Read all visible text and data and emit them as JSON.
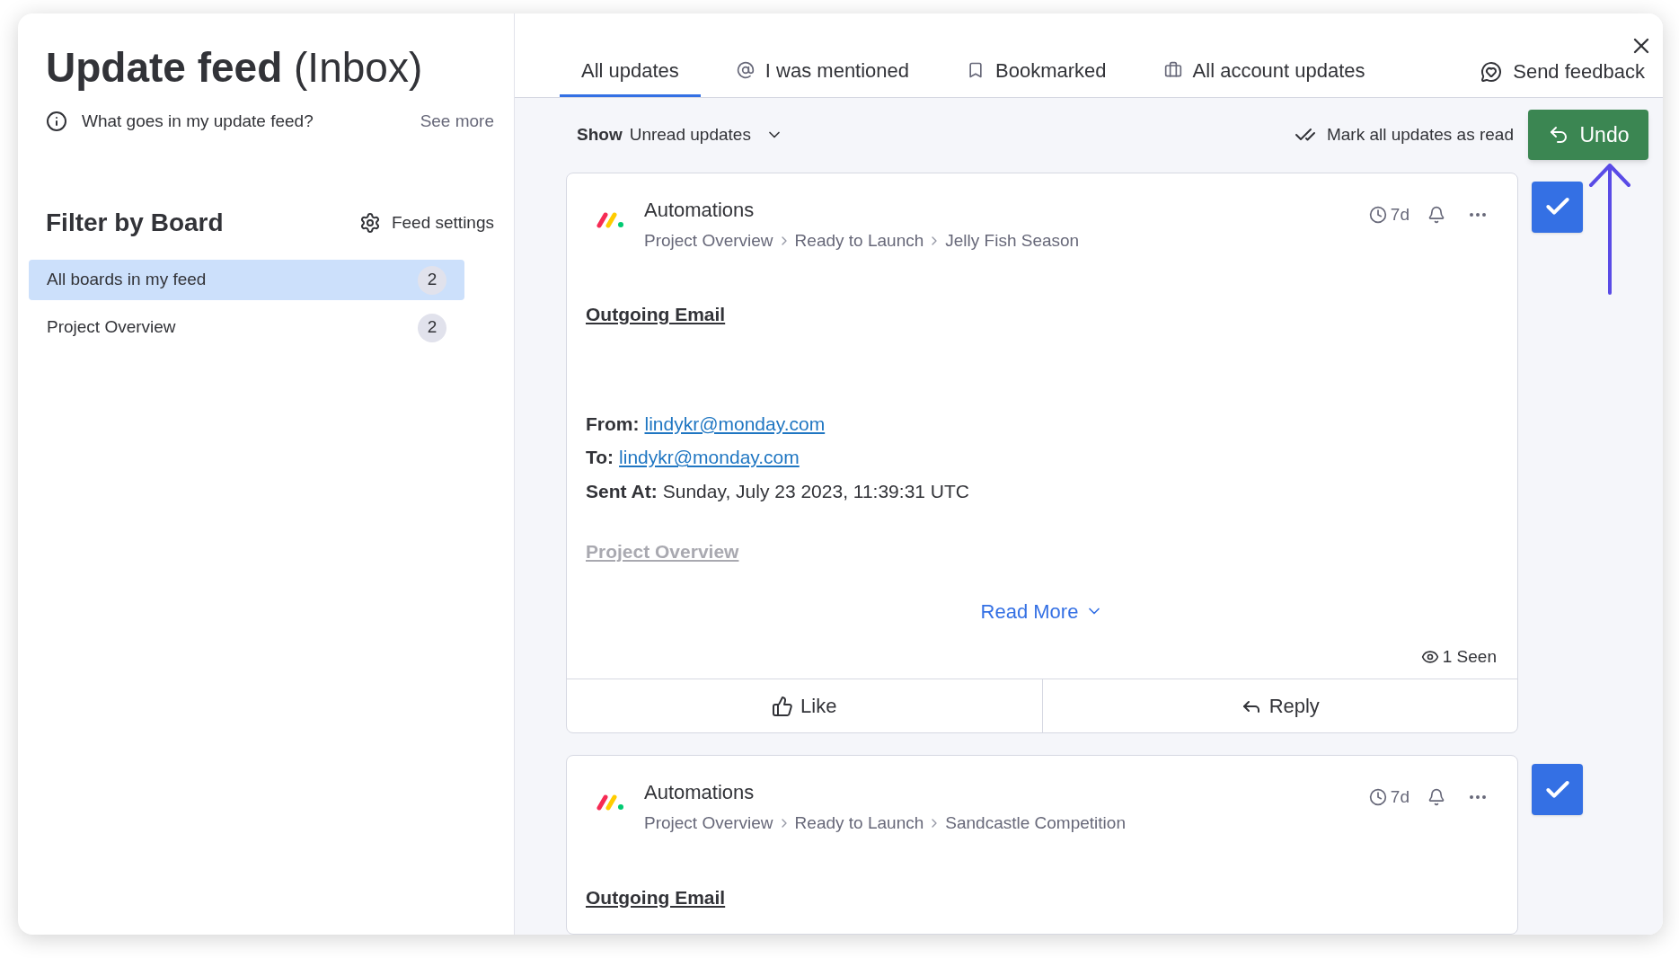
{
  "sidebar": {
    "title": "Update feed",
    "title_suffix": "(Inbox)",
    "info": "What goes in my update feed?",
    "see_more": "See more",
    "filter_title": "Filter by Board",
    "feed_settings": "Feed settings",
    "boards": [
      {
        "label": "All boards in my feed",
        "count": "2",
        "selected": true
      },
      {
        "label": "Project Overview",
        "count": "2",
        "selected": false
      }
    ]
  },
  "tabs": [
    {
      "label": "All updates",
      "kind": "plain",
      "selected": true
    },
    {
      "label": "I was mentioned",
      "kind": "mention",
      "selected": false
    },
    {
      "label": "Bookmarked",
      "kind": "saved",
      "selected": false
    },
    {
      "label": "All account updates",
      "kind": "account",
      "selected": false
    }
  ],
  "send_feedback": "Send feedback",
  "toolbar": {
    "show_label": "Show",
    "show_value": "Unread updates",
    "mark_all": "Mark all updates as read",
    "undo": "Undo"
  },
  "updates": [
    {
      "author": "Automations",
      "breadcrumb": [
        "Project Overview",
        "Ready to Launch",
        "Jelly Fish Season"
      ],
      "age": "7d",
      "checked": true,
      "heading": "Outgoing Email",
      "lines": [
        {
          "label": "From:",
          "value": "lindykr@monday.com",
          "kind": "link"
        },
        {
          "label": "To:",
          "value": "lindykr@monday.com",
          "kind": "link"
        },
        {
          "label": "Sent At:",
          "value": "Sunday, July 23 2023, 11:39:31 UTC",
          "kind": "text"
        }
      ],
      "board_link": "Project Overview",
      "read_more": "Read More",
      "seen": "1 Seen",
      "like": "Like",
      "reply": "Reply"
    },
    {
      "author": "Automations",
      "breadcrumb": [
        "Project Overview",
        "Ready to Launch",
        "Sandcastle Competition"
      ],
      "age": "7d",
      "checked": true,
      "heading": "Outgoing Email"
    }
  ]
}
